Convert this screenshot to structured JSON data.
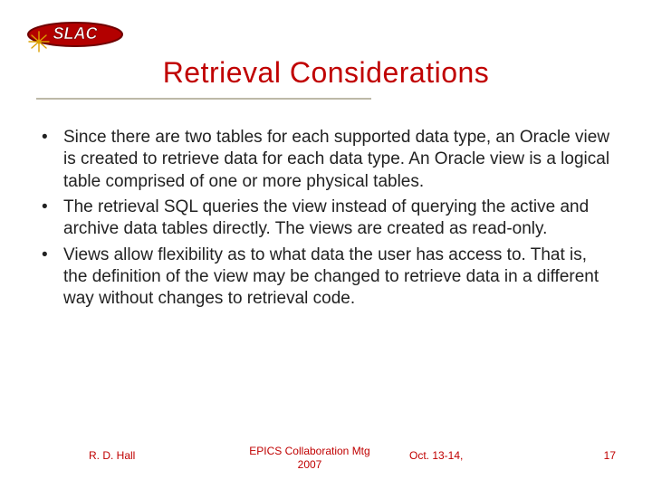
{
  "title": "Retrieval Considerations",
  "bullets": [
    "Since there are two tables for each supported data type, an Oracle view is created to retrieve data for each data type.  An Oracle view is a logical table comprised of one or more physical tables.",
    "The retrieval SQL queries the view instead of querying the active and archive data tables directly.  The views are created as read-only.",
    "Views allow flexibility as to what data the user has access to.  That is, the definition of the view may be changed to retrieve data in a different way without changes to retrieval code."
  ],
  "footer": {
    "author": "R. D. Hall",
    "event": "EPICS Collaboration Mtg 2007",
    "date": "Oct. 13-14,",
    "page": "17"
  },
  "logo": {
    "name": "SLAC"
  }
}
